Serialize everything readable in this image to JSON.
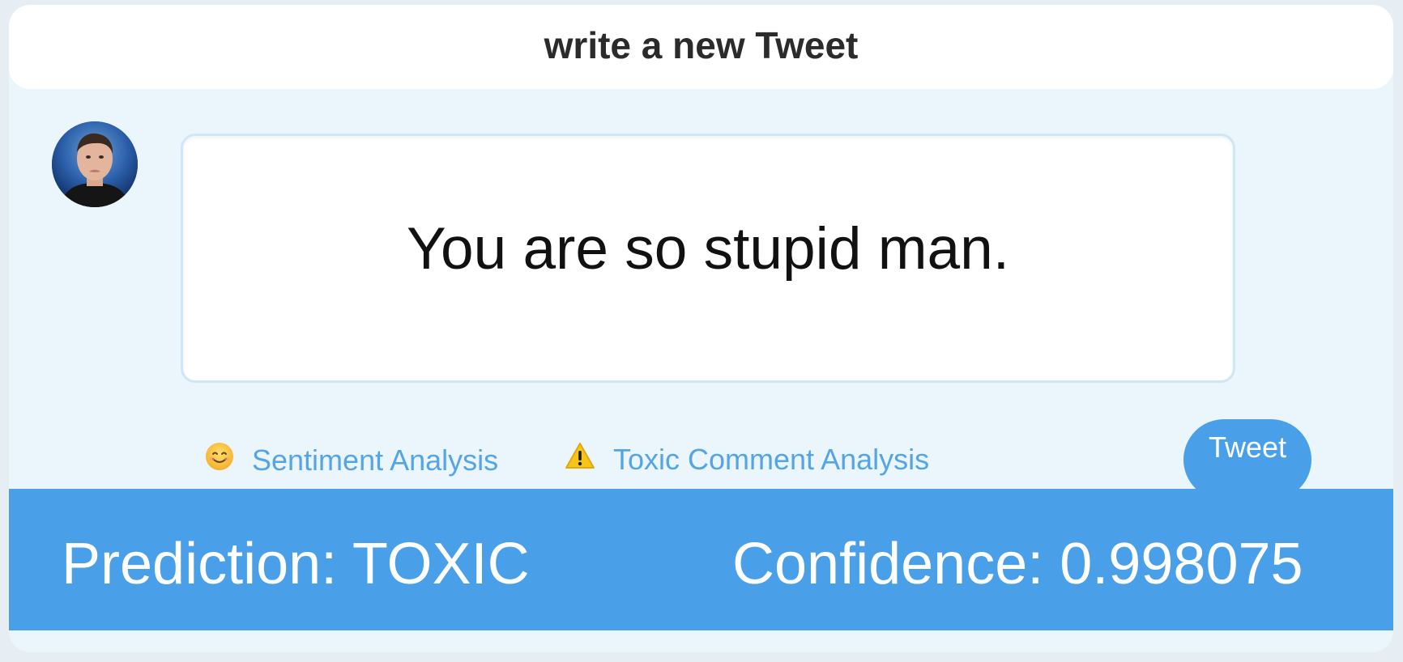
{
  "header": {
    "title": "write a new Tweet"
  },
  "compose": {
    "text": "You are so stupid man."
  },
  "actions": {
    "sentiment": {
      "label": "Sentiment Analysis",
      "icon": "smiley-face-icon"
    },
    "toxic": {
      "label": "Toxic Comment Analysis",
      "icon": "warning-icon"
    },
    "tweet_button": "Tweet"
  },
  "result": {
    "prediction_text": "Prediction: TOXIC",
    "confidence_text": "Confidence: 0.998075"
  },
  "colors": {
    "accent": "#4aa0e8",
    "link": "#55a4e6",
    "panel_background": "#ebf5fc",
    "header_background": "#ffffff",
    "input_border": "#cfe6f7"
  }
}
